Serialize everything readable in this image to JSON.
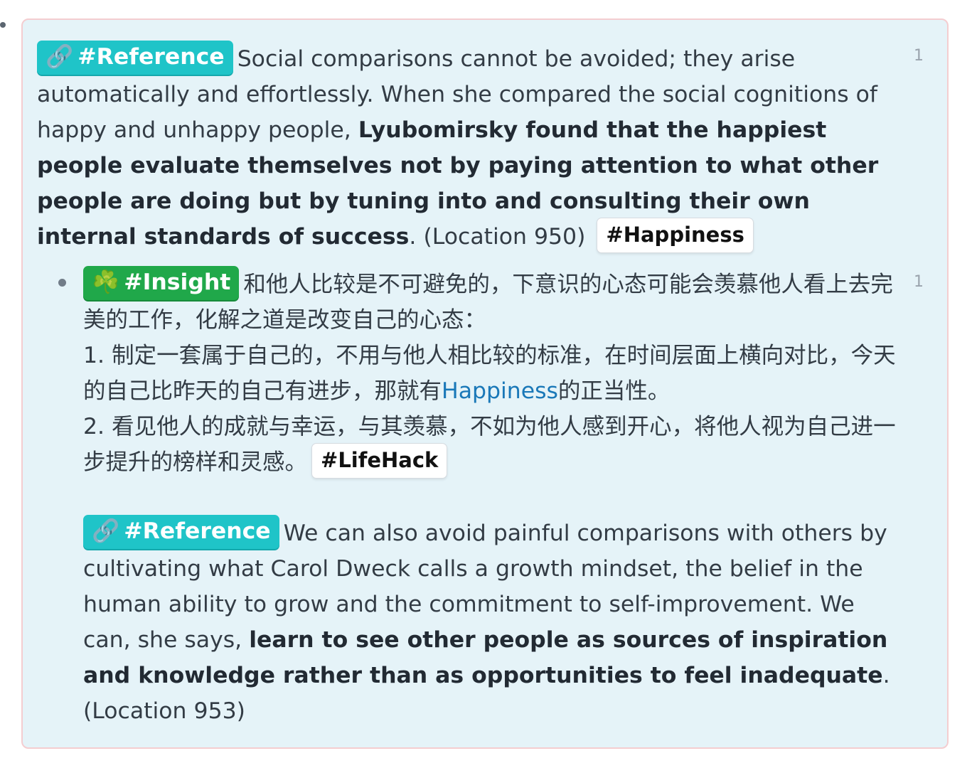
{
  "block1": {
    "tag_icon": "🔗",
    "tag": "#Reference",
    "text_a": "Social comparisons cannot be avoided; they arise automatically and effortlessly. When she compared the social cognitions of happy and unhappy people, ",
    "bold": "Lyubomirsky found that the happiest people evaluate themselves not by paying attention to what other people are doing but by tuning into and consulting their own internal standards of success",
    "text_b": ". (Location 950)",
    "hashtag": "#Happiness",
    "ref_count": "1"
  },
  "block2": {
    "tag_icon": "☘️",
    "tag": "#Insight",
    "line1": "和他人比较是不可避免的，下意识的心态可能会羡慕他人看上去完美的工作，化解之道是改变自己的心态：",
    "item1_a": "1. 制定一套属于自己的，不用与他人相比较的标准，在时间层面上横向对比，今天的自己比昨天的自己有进步，那就有",
    "item1_link": "Happiness",
    "item1_b": "的正当性。",
    "item2": "2. 看见他人的成就与幸运，与其羡慕，不如为他人感到开心，将他人视为自己进一步提升的榜样和灵感。",
    "hashtag": "#LifeHack",
    "ref_count": "1"
  },
  "block3": {
    "tag_icon": "🔗",
    "tag": "#Reference",
    "text_a": "We can also avoid painful comparisons with others by cultivating what Carol Dweck calls a growth mindset, the belief in the human ability to grow and the commitment to self-improvement. We can, she says, ",
    "bold": "learn to see other people as sources of inspiration and knowledge rather than as opportunities to feel inadequate",
    "text_b": ".",
    "location": "(Location 953)"
  }
}
